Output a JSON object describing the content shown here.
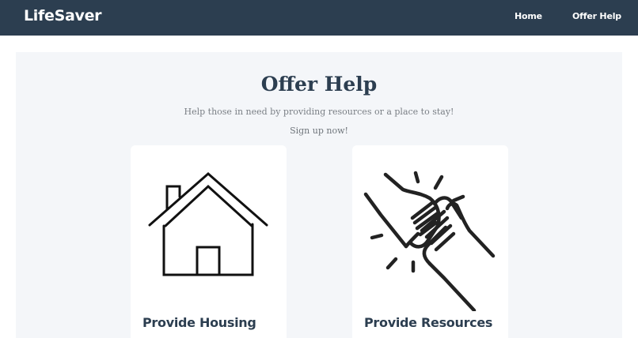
{
  "header": {
    "brand": "LifeSaver",
    "nav": {
      "home": "Home",
      "offer_help": "Offer Help"
    }
  },
  "main": {
    "title": "Offer Help",
    "subtitle": "Help those in need by providing resources or a place to stay!",
    "cta_text": "Sign up now!",
    "cards": [
      {
        "icon": "house-icon",
        "title": "Provide Housing"
      },
      {
        "icon": "helping-hands-icon",
        "title": "Provide Resources"
      }
    ]
  },
  "colors": {
    "navbar_bg": "#2c3e50",
    "panel_bg": "#f4f6f9",
    "heading": "#2c3e50",
    "muted_text": "#7a7f85",
    "card_bg": "#ffffff"
  }
}
